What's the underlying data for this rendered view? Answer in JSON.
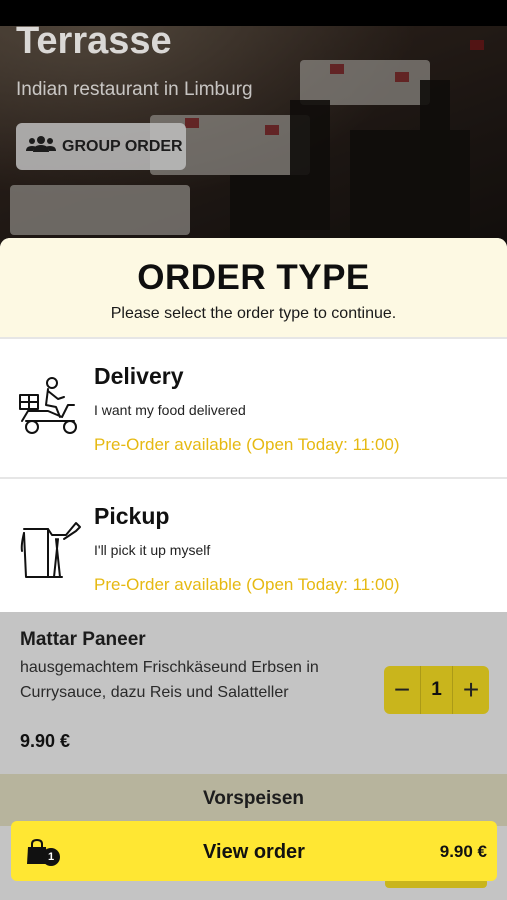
{
  "restaurant": {
    "name": "Terrasse",
    "tagline": "Indian restaurant in Limburg"
  },
  "group_order": {
    "label": "GROUP ORDER",
    "icon": "group-icon"
  },
  "order_type_modal": {
    "title": "ORDER TYPE",
    "subtitle": "Please select the order type to continue.",
    "options": [
      {
        "name": "Delivery",
        "description": "I want my food delivered",
        "availability": "Pre-Order available (Open Today: 11:00)",
        "icon": "scooter-delivery-icon"
      },
      {
        "name": "Pickup",
        "description": "I'll pick it up myself",
        "availability": "Pre-Order available (Open Today: 11:00)",
        "icon": "pickup-bag-icon"
      }
    ]
  },
  "menu_item": {
    "name": "Mattar Paneer",
    "description": "hausgemachtem Frischkäseund Erbsen in Currysauce, dazu Reis und Salatteller",
    "price": "9.90 €",
    "quantity": "1",
    "minus": "−",
    "plus": "+"
  },
  "section": {
    "title": "Vorspeisen"
  },
  "cart": {
    "label": "View order",
    "total": "9.90 €",
    "count": "1",
    "icon": "shopping-bag-icon"
  },
  "colors": {
    "accent": "#ffe733",
    "preorder_text": "#e6b912",
    "modal_header": "#fdf9e3"
  }
}
